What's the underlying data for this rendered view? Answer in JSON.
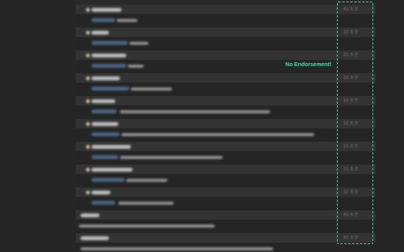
{
  "annotation": {
    "label": "No Endorsement!",
    "accent_color": "#3fd8a8"
  },
  "feed": {
    "items": [
      {
        "time": "43 초 전"
      },
      {
        "time": "23 초 전"
      },
      {
        "time": "22 초 전"
      },
      {
        "time": "19 초 전"
      },
      {
        "time": "16 초 전"
      },
      {
        "time": "13 초 전"
      },
      {
        "time": "15 초 전"
      },
      {
        "time": "11 초 전"
      },
      {
        "time": "12 초 전"
      },
      {
        "time": "41 초 전"
      },
      {
        "time": "43 초 전"
      }
    ]
  }
}
